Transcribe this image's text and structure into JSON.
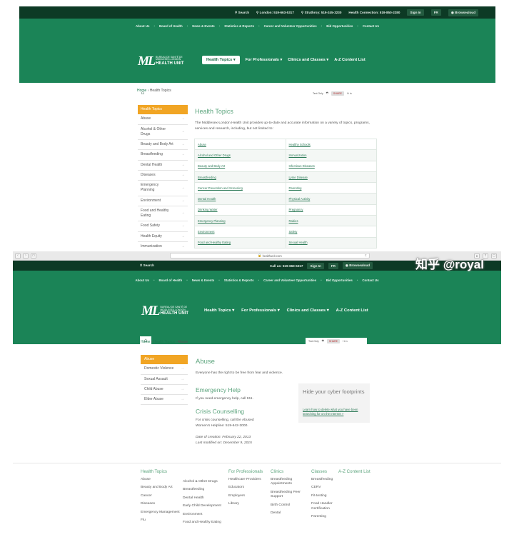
{
  "shot1": {
    "topbar": {
      "search": "Search",
      "london": "London: 519-663-5317",
      "strathroy": "Strathroy: 519-245-3230",
      "health_connection": "Health Connection: 519-850-2280",
      "signin": "Sign In",
      "fr": "FR",
      "browsealoud": "Browsealoud"
    },
    "menu": [
      "About Us",
      "Board of Health",
      "News & Events",
      "Statistics & Reports",
      "Career and Volunteer Opportunities",
      "Bid Opportunities",
      "Contact Us"
    ],
    "logo": {
      "mark": "ML",
      "line1": "BUREAU DE SANTÉ DE",
      "line2": "MIDDLESEX-LONDON",
      "line3": "HEALTH UNIT"
    },
    "nav": [
      "Health Topics",
      "For Professionals",
      "Clinics and Classes",
      "A-Z Content List"
    ],
    "tools": {
      "label": "Text Only",
      "share": "SHARE"
    },
    "breadcrumb": {
      "home": "Home",
      "current": "Health Topics"
    },
    "sidebar": [
      "Health Topics",
      "Abuse",
      "Alcohol & Other Drugs",
      "Beauty and Body Art",
      "Breastfeeding",
      "Dental Health",
      "Diseases",
      "Emergency Planning",
      "Environment",
      "Food and Healthy Eating",
      "Food Safety",
      "Health Equity",
      "Immunization"
    ],
    "title": "Health Topics",
    "intro": "The Middlesex-London Health Unit provides up-to-date and accurate information on a variety of topics, programs, services and research, including, but not limited to:",
    "topics": [
      [
        "Abuse",
        "Healthy Schools"
      ],
      [
        "Alcohol and Other Drugs",
        "Immunization"
      ],
      [
        "Beauty and Body Art",
        "Infectious Diseases"
      ],
      [
        "Breastfeeding",
        "Lyme Disease"
      ],
      [
        "Cancer Prevention and Screening",
        "Parenting"
      ],
      [
        "Dental Health",
        "Physical Activity"
      ],
      [
        "Drinking Water",
        "Pregnancy"
      ],
      [
        "Emergency Planning",
        "Rabies"
      ],
      [
        "Environment",
        "Safety"
      ],
      [
        "Food and Healthy Eating",
        "Sexual Health"
      ]
    ]
  },
  "shot2": {
    "browser": {
      "url": "healthunit.com",
      "reload": "c"
    },
    "topbar": {
      "search": "Search",
      "callus_label": "Call us:",
      "callus_number": "519-663-5317",
      "signin": "Sign In",
      "fr": "FR",
      "browsealoud": "Browsealoud"
    },
    "menu": [
      "About Us",
      "Board of Health",
      "News & Events",
      "Statistics & Reports",
      "Career and Volunteer Opportunities",
      "Bid Opportunities",
      "Contact Us"
    ],
    "logo": {
      "mark": "ML",
      "line1": "BUREAU DE SANTÉ DE",
      "line2": "MIDDLESEX-LONDON",
      "line3": "HEALTH UNIT"
    },
    "nav": [
      "Health Topics",
      "For Professionals",
      "Clinics and Classes",
      "A-Z Content List"
    ],
    "tools": {
      "label": "Text Only",
      "share": "SHARE"
    },
    "breadcrumb": {
      "home": "Home",
      "mid": "Health Topics",
      "current": "Abuse"
    },
    "sidebar": [
      "Abuse",
      "Domestic Violence",
      "Sexual Assault",
      "Child Abuse",
      "Elder Abuse"
    ],
    "title": "Abuse",
    "intro": "Everyone has the right to be free from fear and violence.",
    "emergency": {
      "heading": "Emergency Help",
      "text": "If you need emergency help, call 911."
    },
    "crisis": {
      "heading": "Crisis Counselling",
      "text": "For crisis counselling, call the Abused Women's Helpline: 519-642-3000."
    },
    "dates": {
      "created": "Date of creation: February 22, 2013",
      "modified": "Last modified on: December 9, 2015"
    },
    "cyber": {
      "title": "Hide your cyber footprints",
      "link": "Learn how to delete what you have been searching for on the Internet »"
    },
    "footer": {
      "health_topics": {
        "heading": "Health Topics",
        "col1": [
          "Abuse",
          "Beauty and Body Art",
          "Cancer",
          "Diseases",
          "Emergency Management",
          "Flu"
        ],
        "col2": [
          "Alcohol & Other Drugs",
          "Breastfeeding",
          "Dental Health",
          "Early Child Development",
          "Environment",
          "Food and Healthy Eating"
        ]
      },
      "professionals": {
        "heading": "For Professionals",
        "items": [
          "Healthcare Providers",
          "Educators",
          "Employers",
          "Library"
        ]
      },
      "clinics": {
        "heading": "Clinics",
        "items": [
          "Breastfeeding Appointments",
          "Breastfeeding Peer Support",
          "Birth Control",
          "Dental"
        ]
      },
      "classes": {
        "heading": "Classes",
        "items": [
          "Breastfeeding",
          "CERV",
          "Fit-testing",
          "Food Handler Certification",
          "Parenting"
        ]
      },
      "az": {
        "heading": "A-Z Content List"
      }
    }
  },
  "watermark": "知乎 @royal",
  "colors": {
    "dark_green": "#0d3a25",
    "brand_green": "#1b8457",
    "accent_orange": "#f1a524",
    "heading_green": "#5da57e",
    "link_green": "#2c7a57"
  }
}
